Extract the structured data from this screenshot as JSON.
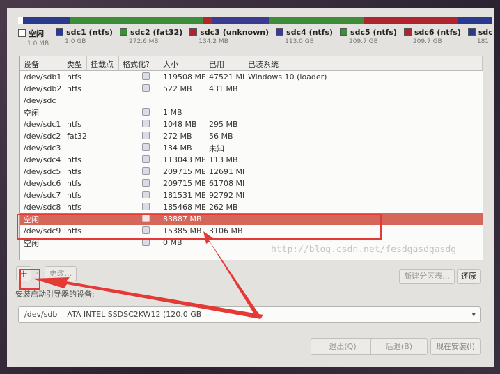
{
  "partition_bar": [
    {
      "name": "free",
      "color": "#ffffff",
      "flex": 1
    },
    {
      "name": "sdc1",
      "color": "#2a3a8c",
      "flex": 10
    },
    {
      "name": "sdc2",
      "color": "#3c8c3a",
      "flex": 28
    },
    {
      "name": "sdc3",
      "color": "#b0242e",
      "flex": 2
    },
    {
      "name": "sdc4",
      "color": "#3a3a90",
      "flex": 12
    },
    {
      "name": "sdc5",
      "color": "#3c8c3a",
      "flex": 20
    },
    {
      "name": "sdc6",
      "color": "#b0242e",
      "flex": 20
    },
    {
      "name": "rest",
      "color": "#2a3a8c",
      "flex": 7
    }
  ],
  "legend": [
    {
      "name": "空闲",
      "size": "1.0 MB",
      "color": "#ffffff"
    },
    {
      "name": "sdc1 (ntfs)",
      "size": "1.0 GB",
      "color": "#2a3a8c"
    },
    {
      "name": "sdc2 (fat32)",
      "size": "272.6 MB",
      "color": "#3c8c3a"
    },
    {
      "name": "sdc3 (unknown)",
      "size": "134.2 MB",
      "color": "#b0242e"
    },
    {
      "name": "sdc4 (ntfs)",
      "size": "113.0 GB",
      "color": "#3a3a90"
    },
    {
      "name": "sdc5 (ntfs)",
      "size": "209.7 GB",
      "color": "#3c8c3a"
    },
    {
      "name": "sdc6 (ntfs)",
      "size": "209.7 GB",
      "color": "#b0242e"
    },
    {
      "name": "sdc",
      "size": "181",
      "color": "#2a3a8c"
    }
  ],
  "columns": [
    "设备",
    "类型",
    "挂载点",
    "格式化?",
    "大小",
    "已用",
    "已装系统"
  ],
  "rows": [
    {
      "device": "/dev/sdb1",
      "type": "ntfs",
      "mount": "",
      "format": true,
      "size": "119508 MB",
      "used": "47521 MB",
      "system": "Windows 10 (loader)"
    },
    {
      "device": "/dev/sdb2",
      "type": "ntfs",
      "mount": "",
      "format": true,
      "size": "522 MB",
      "used": "431 MB",
      "system": ""
    },
    {
      "device": "/dev/sdc",
      "type": "",
      "mount": "",
      "format": false,
      "size": "",
      "used": "",
      "system": ""
    },
    {
      "device": "空闲",
      "type": "",
      "mount": "",
      "format": true,
      "size": "1 MB",
      "used": "",
      "system": ""
    },
    {
      "device": "/dev/sdc1",
      "type": "ntfs",
      "mount": "",
      "format": true,
      "size": "1048 MB",
      "used": "295 MB",
      "system": ""
    },
    {
      "device": "/dev/sdc2",
      "type": "fat32",
      "mount": "",
      "format": true,
      "size": "272 MB",
      "used": "56 MB",
      "system": ""
    },
    {
      "device": "/dev/sdc3",
      "type": "",
      "mount": "",
      "format": true,
      "size": "134 MB",
      "used": "未知",
      "system": ""
    },
    {
      "device": "/dev/sdc4",
      "type": "ntfs",
      "mount": "",
      "format": true,
      "size": "113043 MB",
      "used": "113 MB",
      "system": ""
    },
    {
      "device": "/dev/sdc5",
      "type": "ntfs",
      "mount": "",
      "format": true,
      "size": "209715 MB",
      "used": "12691 MB",
      "system": ""
    },
    {
      "device": "/dev/sdc6",
      "type": "ntfs",
      "mount": "",
      "format": true,
      "size": "209715 MB",
      "used": "61708 MB",
      "system": ""
    },
    {
      "device": "/dev/sdc7",
      "type": "ntfs",
      "mount": "",
      "format": true,
      "size": "181531 MB",
      "used": "92792 MB",
      "system": ""
    },
    {
      "device": "/dev/sdc8",
      "type": "ntfs",
      "mount": "",
      "format": true,
      "size": "185468 MB",
      "used": "262 MB",
      "system": ""
    },
    {
      "device": "空闲",
      "type": "",
      "mount": "",
      "format": true,
      "size": "83887 MB",
      "used": "",
      "system": "",
      "selected": true
    },
    {
      "device": "/dev/sdc9",
      "type": "ntfs",
      "mount": "",
      "format": true,
      "size": "15385 MB",
      "used": "3106 MB",
      "system": ""
    },
    {
      "device": "空闲",
      "type": "",
      "mount": "",
      "format": true,
      "size": "0 MB",
      "used": "",
      "system": ""
    }
  ],
  "watermark": "http://blog.csdn.net/fesdgasdgasdg",
  "buttons": {
    "add": "+",
    "remove": "-",
    "change": "更改...",
    "new_table": "新建分区表...",
    "revert": "还原",
    "quit": "退出(Q)",
    "back": "后退(B)",
    "install": "现在安装(I)"
  },
  "bootloader": {
    "label": "安装启动引导器的设备:",
    "device": "/dev/sdb",
    "description": "ATA INTEL SSDSC2KW12 (120.0 GB"
  }
}
